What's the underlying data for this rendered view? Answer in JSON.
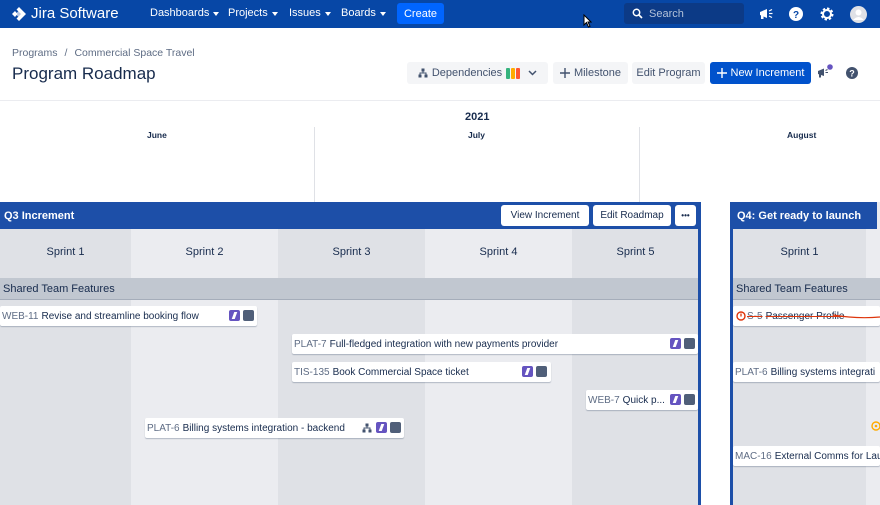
{
  "app": {
    "name": "Jira Software"
  },
  "nav": {
    "items": [
      {
        "label": "Dashboards"
      },
      {
        "label": "Projects"
      },
      {
        "label": "Issues"
      },
      {
        "label": "Boards"
      }
    ],
    "create_label": "Create"
  },
  "search": {
    "placeholder": "Search"
  },
  "breadcrumb": {
    "items": [
      "Programs",
      "/",
      "Commercial Space Travel"
    ]
  },
  "page": {
    "title": "Program Roadmap"
  },
  "toolbar": {
    "dependencies_label": "Dependencies",
    "dependency_colors": [
      "#36b37e",
      "#ffab00",
      "#ff5630"
    ],
    "milestone_label": "Milestone",
    "edit_program_label": "Edit Program",
    "new_increment_label": "New Increment"
  },
  "timeline": {
    "year": "2021",
    "months": [
      "June",
      "July",
      "August"
    ]
  },
  "increments": [
    {
      "title": "Q3 Increment",
      "view_label": "View Increment",
      "edit_label": "Edit Roadmap",
      "more_label": "•••",
      "sprints": [
        "Sprint 1",
        "Sprint 2",
        "Sprint 3",
        "Sprint 4",
        "Sprint 5"
      ],
      "shared_label": "Shared Team Features",
      "cards": [
        {
          "key": "WEB-11",
          "title": "Revise and streamline booking flow"
        },
        {
          "key": "PLAT-7",
          "title": "Full-fledged integration with new payments provider"
        },
        {
          "key": "TIS-135",
          "title": "Book Commercial Space ticket"
        },
        {
          "key": "WEB-7",
          "title": "Quick p..."
        },
        {
          "key": "PLAT-6",
          "title": "Billing systems integration - backend"
        }
      ]
    },
    {
      "title": "Q4: Get ready to launch",
      "sprints": [
        "Sprint 1"
      ],
      "shared_label": "Shared Team Features",
      "cards": [
        {
          "key": "S-5",
          "title": "Passenger Profile"
        },
        {
          "key": "PLAT-6",
          "title": "Billing systems integrati"
        },
        {
          "key": "MAC-16",
          "title": "External Comms for Lau"
        }
      ]
    }
  ],
  "colors": {
    "nav_bg": "#0747a6",
    "primary": "#0052cc",
    "increment_header": "#1d4fa8",
    "epic": "#6554c0",
    "team": "#505f79"
  }
}
